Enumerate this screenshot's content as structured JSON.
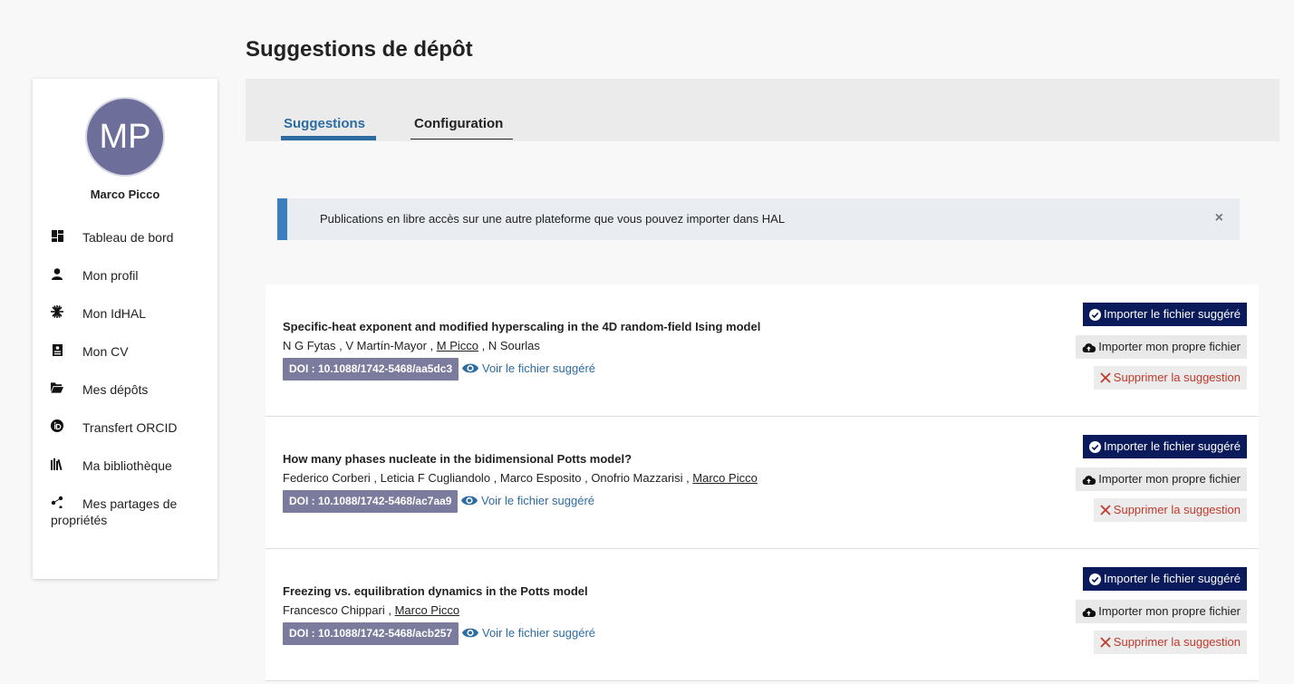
{
  "page_title": "Suggestions de dépôt",
  "user": {
    "initials": "MP",
    "name": "Marco Picco"
  },
  "nav": [
    {
      "label": "Tableau de bord",
      "icon": "dashboard-icon"
    },
    {
      "label": "Mon profil",
      "icon": "person-icon"
    },
    {
      "label": "Mon IdHAL",
      "icon": "asterisk-icon"
    },
    {
      "label": "Mon CV",
      "icon": "cv-icon"
    },
    {
      "label": "Mes dépôts",
      "icon": "folder-icon"
    },
    {
      "label": "Transfert ORCID",
      "icon": "orcid-icon"
    },
    {
      "label": "Ma bibliothèque",
      "icon": "library-icon"
    },
    {
      "label": "Mes partages de propriétés",
      "icon": "share-icon"
    }
  ],
  "tabs": {
    "suggestions": "Suggestions",
    "configuration": "Configuration"
  },
  "alert": {
    "text": "Publications en libre accès sur une autre plateforme que vous pouvez importer dans HAL",
    "close": "×"
  },
  "labels": {
    "import_suggested": "Importer le fichier suggéré",
    "import_own": "Importer mon propre fichier",
    "delete": "Supprimer la suggestion",
    "view": "Voir le fichier suggéré"
  },
  "suggestions": [
    {
      "title": "Specific-heat exponent and modified hyperscaling in the 4D random-field Ising model",
      "authors_before": "N G Fytas , V Martín-Mayor , ",
      "authors_highlight": "M Picco",
      "authors_after": " , N Sourlas",
      "doi": "DOI : 10.1088/1742-5468/aa5dc3"
    },
    {
      "title": "How many phases nucleate in the bidimensional Potts model?",
      "authors_before": "Federico Corberi , Leticia F Cugliandolo , Marco Esposito , Onofrio Mazzarisi , ",
      "authors_highlight": "Marco Picco",
      "authors_after": "",
      "doi": "DOI : 10.1088/1742-5468/ac7aa9"
    },
    {
      "title": "Freezing vs. equilibration dynamics in the Potts model",
      "authors_before": "Francesco Chippari , ",
      "authors_highlight": "Marco Picco",
      "authors_after": "",
      "doi": "DOI : 10.1088/1742-5468/acb257"
    }
  ],
  "colors": {
    "accent": "#2d6ca3",
    "primary_button": "#0b1a5a",
    "doi_badge": "#7b7b9e",
    "delete": "#c0392b"
  }
}
